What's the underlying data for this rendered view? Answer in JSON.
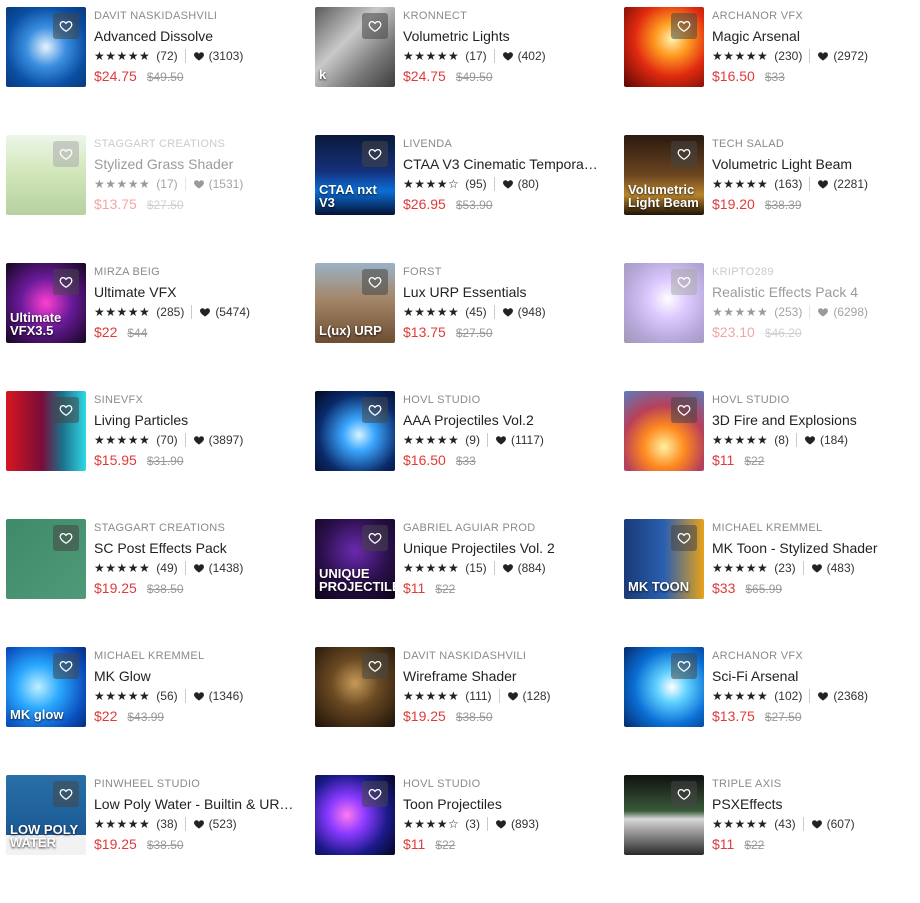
{
  "products": [
    {
      "publisher": "DAVIT NASKIDASHVILI",
      "title": "Advanced Dissolve",
      "stars": "★★★★★",
      "rating_count": "(72)",
      "fav_count": "(3103)",
      "price": "$24.75",
      "original_price": "$49.50",
      "thumb_bg": "radial-gradient(circle,#e8f4ff 0%,#3b8fe0 35%,#0b4fa3 70%,#083a7c 100%)",
      "thumb_label": "",
      "dim": false
    },
    {
      "publisher": "KRONNECT",
      "title": "Volumetric Lights",
      "stars": "★★★★★",
      "rating_count": "(17)",
      "fav_count": "(402)",
      "price": "$24.75",
      "original_price": "$49.50",
      "thumb_bg": "linear-gradient(135deg,#5b5b5b 0%,#c9c9c9 40%,#7a7a7a 70%,#3c3c3c 100%)",
      "thumb_label": "k",
      "dim": false
    },
    {
      "publisher": "ARCHANOR VFX",
      "title": "Magic Arsenal",
      "stars": "★★★★★",
      "rating_count": "(230)",
      "fav_count": "(2972)",
      "price": "$16.50",
      "original_price": "$33",
      "thumb_bg": "radial-gradient(circle at 60% 40%,#fff2b0 0%,#ff9a1f 25%,#e02a10 55%,#5a0505 100%)",
      "thumb_label": "",
      "dim": false
    },
    {
      "publisher": "STAGGART CREATIONS",
      "title": "Stylized Grass Shader",
      "stars": "★★★★★",
      "rating_count": "(17)",
      "fav_count": "(1531)",
      "price": "$13.75",
      "original_price": "$27.50",
      "thumb_bg": "linear-gradient(180deg,#d9ecd0 0%,#9ccc6a 45%,#5f9a2e 100%)",
      "thumb_label": "",
      "dim": true
    },
    {
      "publisher": "LIVENDA",
      "title": "CTAA V3 Cinematic Tempora…",
      "stars": "★★★★☆",
      "rating_count": "(95)",
      "fav_count": "(80)",
      "price": "$26.95",
      "original_price": "$53.90",
      "thumb_bg": "linear-gradient(180deg,#0a1a3a 0%,#15307a 45%,#0a6fd6 70%,#061236 100%)",
      "thumb_label": "CTAA nxt V3",
      "dim": false
    },
    {
      "publisher": "TECH SALAD",
      "title": "Volumetric Light Beam",
      "stars": "★★★★★",
      "rating_count": "(163)",
      "fav_count": "(2281)",
      "price": "$19.20",
      "original_price": "$38.39",
      "thumb_bg": "linear-gradient(180deg,#2a1a10 0%,#6b4520 50%,#b8862e 75%,#201208 100%)",
      "thumb_label": "Volumetric Light Beam",
      "dim": false
    },
    {
      "publisher": "MIRZA BEIG",
      "title": "Ultimate VFX",
      "stars": "★★★★★",
      "rating_count": "(285)",
      "fav_count": "(5474)",
      "price": "$22",
      "original_price": "$44",
      "thumb_bg": "radial-gradient(circle at 50% 50%,#ff3fd2 0%,#6a1a9a 45%,#14061f 100%)",
      "thumb_label": "Ultimate VFX3.5",
      "dim": false
    },
    {
      "publisher": "FORST",
      "title": "Lux URP Essentials",
      "stars": "★★★★★",
      "rating_count": "(45)",
      "fav_count": "(948)",
      "price": "$13.75",
      "original_price": "$27.50",
      "thumb_bg": "linear-gradient(180deg,#9bb2c4 0%,#a48668 45%,#6e4e33 100%)",
      "thumb_label": "L(ux) URP",
      "dim": false
    },
    {
      "publisher": "KRIPTO289",
      "title": "Realistic Effects Pack 4",
      "stars": "★★★★★",
      "rating_count": "(253)",
      "fav_count": "(6298)",
      "price": "$23.10",
      "original_price": "$46.20",
      "thumb_bg": "radial-gradient(circle at 55% 45%,#ffffff 0%,#b58cff 30%,#5a3aa8 70%,#2a1a55 100%)",
      "thumb_label": "",
      "dim": true
    },
    {
      "publisher": "SINEVFX",
      "title": "Living Particles",
      "stars": "★★★★★",
      "rating_count": "(70)",
      "fav_count": "(3897)",
      "price": "$15.95",
      "original_price": "$31.90",
      "thumb_bg": "linear-gradient(90deg,#d6171f 0%,#7a0c3a 45%,#1c6f8a 70%,#2fd9e6 100%)",
      "thumb_label": "",
      "dim": false
    },
    {
      "publisher": "HOVL STUDIO",
      "title": "AAA Projectiles Vol.2",
      "stars": "★★★★★",
      "rating_count": "(9)",
      "fav_count": "(1117)",
      "price": "$16.50",
      "original_price": "$33",
      "thumb_bg": "radial-gradient(circle at 55% 55%,#d8f4ff 0%,#3ca7ff 25%,#0a2a6a 65%,#020a1f 100%)",
      "thumb_label": "",
      "dim": false
    },
    {
      "publisher": "HOVL STUDIO",
      "title": "3D Fire and Explosions",
      "stars": "★★★★★",
      "rating_count": "(8)",
      "fav_count": "(184)",
      "price": "$11",
      "original_price": "$22",
      "thumb_bg": "radial-gradient(circle at 50% 70%,#fff1a0 0%,#ff8a1f 30%,#b8405a 60%,#5a7dbd 100%)",
      "thumb_label": "",
      "dim": false
    },
    {
      "publisher": "STAGGART CREATIONS",
      "title": "SC Post Effects Pack",
      "stars": "★★★★★",
      "rating_count": "(49)",
      "fav_count": "(1438)",
      "price": "$19.25",
      "original_price": "$38.50",
      "thumb_bg": "linear-gradient(135deg,#3f8a6a 0%,#4f9a78 100%)",
      "thumb_label": "",
      "dim": false
    },
    {
      "publisher": "GABRIEL AGUIAR PROD",
      "title": "Unique Projectiles Vol. 2",
      "stars": "★★★★★",
      "rating_count": "(15)",
      "fav_count": "(884)",
      "price": "$11",
      "original_price": "$22",
      "thumb_bg": "radial-gradient(circle at 50% 40%,#6a2ab0 0%,#2a0f4a 55%,#0c0518 100%)",
      "thumb_label": "UNIQUE PROJECTILES",
      "dim": false
    },
    {
      "publisher": "MICHAEL KREMMEL",
      "title": "MK Toon - Stylized Shader",
      "stars": "★★★★★",
      "rating_count": "(23)",
      "fav_count": "(483)",
      "price": "$33",
      "original_price": "$65.99",
      "thumb_bg": "linear-gradient(90deg,#1a3a78 0%,#2a5fb0 50%,#e8a21a 100%)",
      "thumb_label": "MK TOON",
      "dim": false
    },
    {
      "publisher": "MICHAEL KREMMEL",
      "title": "MK Glow",
      "stars": "★★★★★",
      "rating_count": "(56)",
      "fav_count": "(1346)",
      "price": "$22",
      "original_price": "$43.99",
      "thumb_bg": "radial-gradient(circle at 40% 50%,#bff0ff 0%,#2aa8ff 35%,#0a4fbf 75%,#062e7a 100%)",
      "thumb_label": "MK glow",
      "dim": false
    },
    {
      "publisher": "DAVIT NASKIDASHVILI",
      "title": "Wireframe Shader",
      "stars": "★★★★★",
      "rating_count": "(111)",
      "fav_count": "(128)",
      "price": "$19.25",
      "original_price": "$38.50",
      "thumb_bg": "radial-gradient(circle at 50% 45%,#c79a5a 0%,#6b4a22 40%,#1c1208 100%)",
      "thumb_label": "",
      "dim": false
    },
    {
      "publisher": "ARCHANOR VFX",
      "title": "Sci-Fi Arsenal",
      "stars": "★★★★★",
      "rating_count": "(102)",
      "fav_count": "(2368)",
      "price": "$13.75",
      "original_price": "$27.50",
      "thumb_bg": "radial-gradient(circle at 60% 50%,#ffffff 0%,#5fd0ff 25%,#0a6fd6 60%,#042a6a 100%)",
      "thumb_label": "",
      "dim": false
    },
    {
      "publisher": "PINWHEEL STUDIO",
      "title": "Low Poly Water - Builtin & UR…",
      "stars": "★★★★★",
      "rating_count": "(38)",
      "fav_count": "(523)",
      "price": "$19.25",
      "original_price": "$38.50",
      "thumb_bg": "linear-gradient(180deg,#2a6fa8 0%,#1a5a94 75%,#f2f2f2 75%,#f2f2f2 100%)",
      "thumb_label": "LOW POLY WATER",
      "dim": false
    },
    {
      "publisher": "HOVL STUDIO",
      "title": "Toon Projectiles",
      "stars": "★★★★☆",
      "rating_count": "(3)",
      "fav_count": "(893)",
      "price": "$11",
      "original_price": "$22",
      "thumb_bg": "radial-gradient(circle at 40% 50%,#ff7af0 0%,#8a3aff 30%,#1a1a8a 65%,#050520 100%)",
      "thumb_label": "",
      "dim": false
    },
    {
      "publisher": "TRIPLE AXIS",
      "title": "PSXEffects",
      "stars": "★★★★★",
      "rating_count": "(43)",
      "fav_count": "(607)",
      "price": "$11",
      "original_price": "$22",
      "thumb_bg": "linear-gradient(180deg,#111 0%,#3a5a3a 45%,#d8d8d8 55%,#2a2a2a 100%)",
      "thumb_label": "",
      "dim": false
    }
  ]
}
